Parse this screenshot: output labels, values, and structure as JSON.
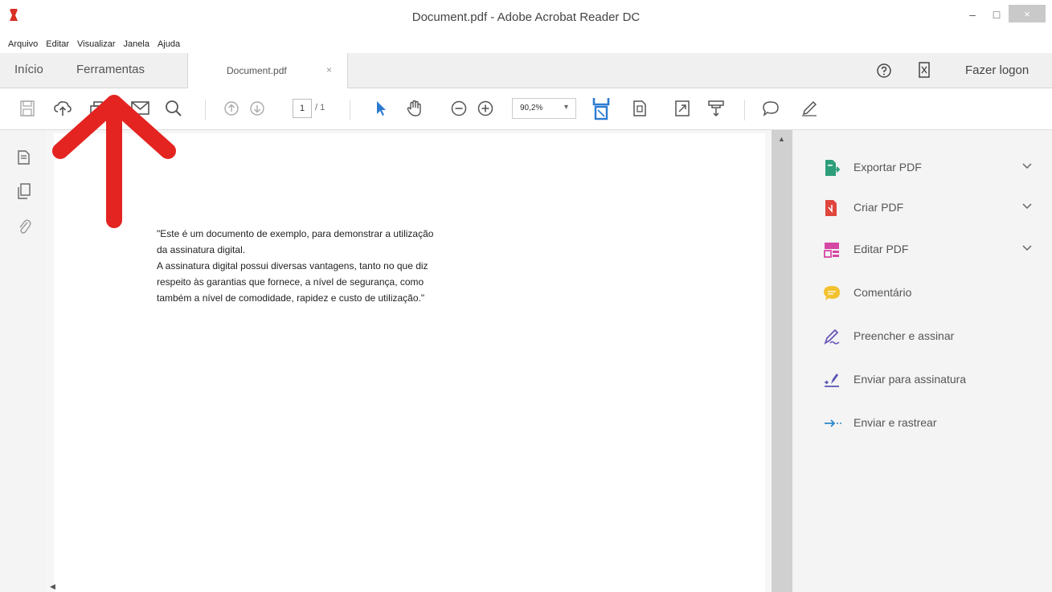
{
  "window": {
    "title": "Document.pdf - Adobe Acrobat Reader DC",
    "minimize": "–",
    "maximize": "□",
    "close": "×"
  },
  "menu": [
    "Arquivo",
    "Editar",
    "Visualizar",
    "Janela",
    "Ajuda"
  ],
  "tabs": {
    "home": "Início",
    "tools": "Ferramentas",
    "document": "Document.pdf",
    "document_close": "×",
    "logon": "Fazer logon"
  },
  "toolbar": {
    "page_current": "1",
    "page_total": "/ 1",
    "zoom": "90,2%",
    "zoom_arrow": "▾"
  },
  "document": {
    "lines": [
      "\"Este é um documento de exemplo, para demonstrar a utilização",
      "da assinatura digital.",
      "A assinatura digital possui diversas vantagens, tanto no que diz",
      "respeito às garantias que fornece, a nível de segurança, como",
      "também a nível de comodidade, rapidez e custo de utilização.\""
    ]
  },
  "scroll": {
    "up": "▲",
    "left": "◀"
  },
  "tools_panel": {
    "items": [
      {
        "label": "Exportar PDF",
        "icon": "export-pdf-icon",
        "color": "#2e9e7a"
      },
      {
        "label": "Criar PDF",
        "icon": "create-pdf-icon",
        "color": "#e0463e"
      },
      {
        "label": "Editar PDF",
        "icon": "edit-pdf-icon",
        "color": "#d548a3"
      },
      {
        "label": "Comentário",
        "icon": "comment-icon",
        "color": "#f2c12e"
      },
      {
        "label": "Preencher e assinar",
        "icon": "fill-sign-icon",
        "color": "#6b57b8"
      },
      {
        "label": "Enviar para assinatura",
        "icon": "send-signature-icon",
        "color": "#5a55b3"
      },
      {
        "label": "Enviar e rastrear",
        "icon": "send-track-icon",
        "color": "#2c86c8"
      }
    ]
  },
  "colors": {
    "accent_blue": "#2c7bd1",
    "arrow_red": "#e32421"
  }
}
